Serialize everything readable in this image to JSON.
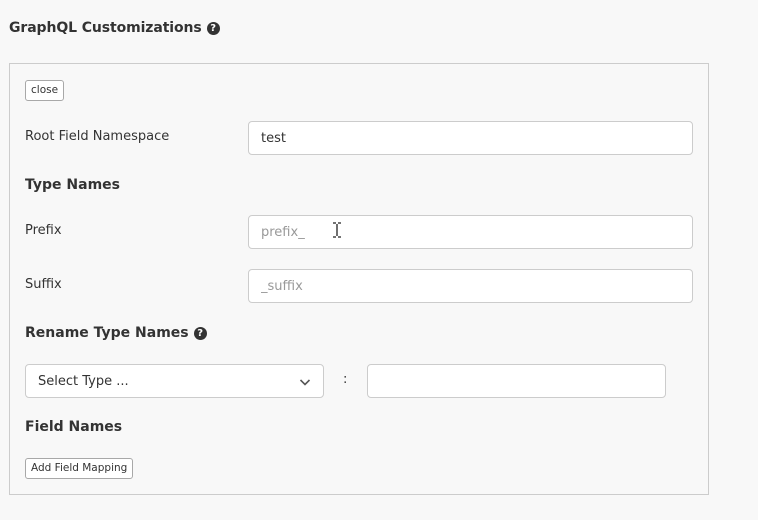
{
  "header": {
    "title": "GraphQL Customizations",
    "help_icon": "question-circle-icon"
  },
  "panel": {
    "close_label": "close",
    "root_field_namespace": {
      "label": "Root Field Namespace",
      "value": "test"
    },
    "type_names": {
      "title": "Type Names",
      "prefix": {
        "label": "Prefix",
        "placeholder": "prefix_"
      },
      "suffix": {
        "label": "Suffix",
        "placeholder": "_suffix"
      }
    },
    "rename_type_names": {
      "title": "Rename Type Names",
      "help_icon": "question-circle-icon",
      "select_placeholder": "Select Type ...",
      "separator": ":",
      "new_name_value": ""
    },
    "field_names": {
      "title": "Field Names",
      "add_mapping_label": "Add Field Mapping"
    }
  }
}
